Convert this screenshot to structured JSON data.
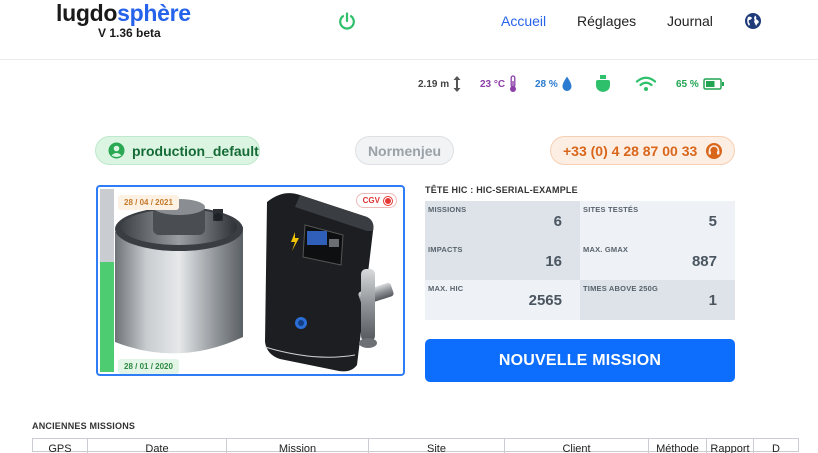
{
  "brand": {
    "logo_part1": "lugdo",
    "logo_part2": "sphère",
    "version": "V 1.36 beta"
  },
  "nav": {
    "home": "Accueil",
    "settings": "Réglages",
    "journal": "Journal"
  },
  "status": {
    "height": "2.19 m",
    "temperature": "23 °C",
    "humidity": "28 %",
    "battery": "65 %",
    "battery_level": 0.65
  },
  "user": {
    "profile": "production_default",
    "organization": "Normenjeu",
    "support_phone": "+33 (0) 4 28 87 00 33"
  },
  "device": {
    "date_top": "28 / 04 / 2021",
    "date_bottom": "28 / 01 / 2020",
    "cgv_label": "CGV",
    "life_level": 0.6,
    "head_title": "TÊTE HIC : HIC-SERIAL-EXAMPLE"
  },
  "stats": {
    "missions_label": "MISSIONS",
    "missions_value": "6",
    "sites_label": "SITES TESTÉS",
    "sites_value": "5",
    "impacts_label": "IMPACTS",
    "impacts_value": "16",
    "gmax_label": "MAX. GMAX",
    "gmax_value": "887",
    "hic_label": "MAX. HIC",
    "hic_value": "2565",
    "times_label": "TIMES ABOVE 250G",
    "times_value": "1"
  },
  "cta": {
    "new_mission": "NOUVELLE MISSION"
  },
  "old_missions": {
    "title": "ANCIENNES MISSIONS",
    "columns": [
      "GPS",
      "Date",
      "Mission",
      "Site",
      "Client",
      "Méthode",
      "Rapport",
      "D"
    ]
  },
  "colors": {
    "accent": "#2563eb",
    "button": "#0d6efd",
    "success": "#4dcc72",
    "warning": "#d9661b"
  }
}
